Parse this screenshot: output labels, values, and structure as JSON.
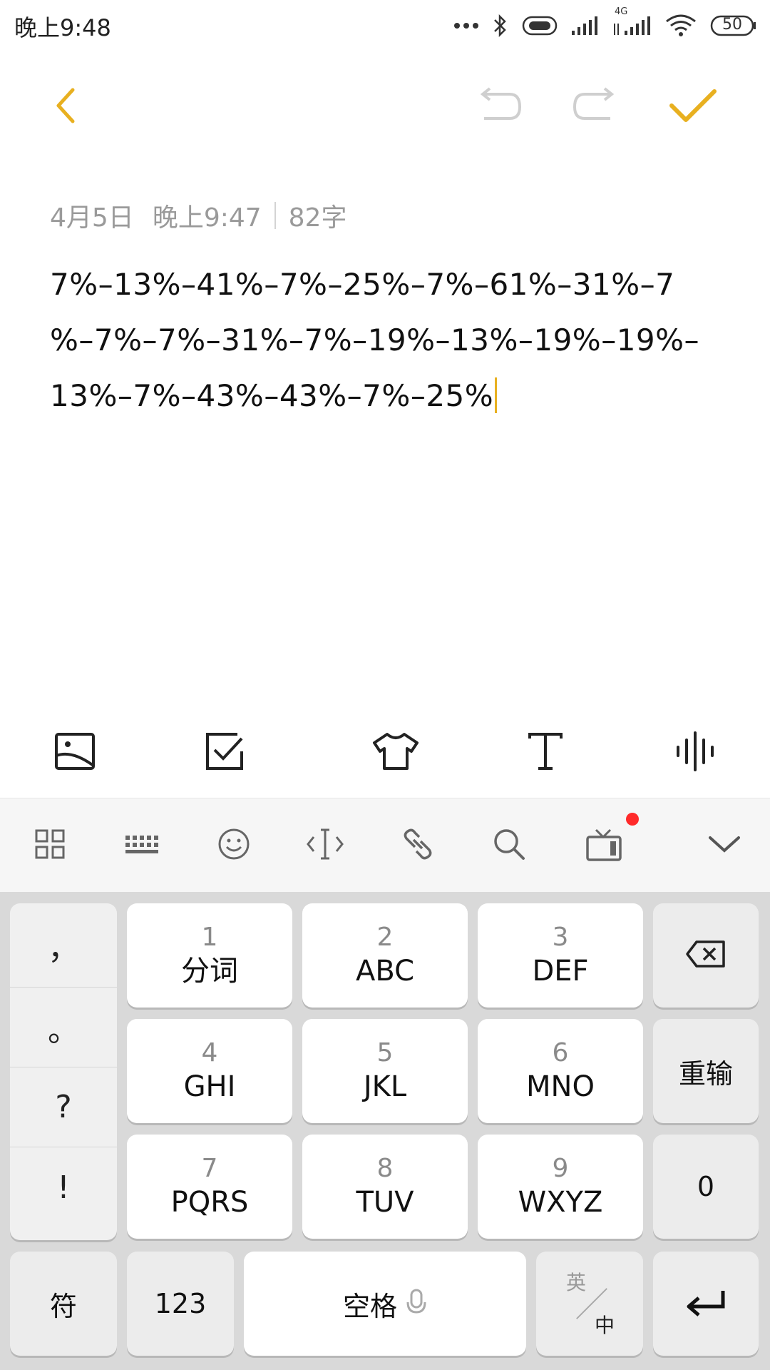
{
  "status_bar": {
    "time": "晚上9:48",
    "network_label": "4G",
    "battery": "50",
    "icons": [
      "more-dots-icon",
      "bluetooth-icon",
      "vibrate-icon",
      "signal-icon",
      "signal-4g-icon",
      "wifi-icon",
      "battery-icon"
    ]
  },
  "toolbar": {
    "icons": [
      "back-arrow-icon",
      "undo-icon",
      "redo-icon",
      "checkmark-icon"
    ],
    "accent_color": "#e8b020",
    "disabled_color": "#cfcfcf"
  },
  "note": {
    "date": "4月5日",
    "time": "晚上9:47",
    "char_count": "82字",
    "lines": [
      "7%–13%–41%–7%–25%–7%–61%–31%–7",
      "%–7%–7%–31%–7%–19%–13%–19%–19%–",
      "13%–7%–43%–43%–7%–25%"
    ]
  },
  "format_bar": {
    "icons": [
      "image-icon",
      "checkbox-icon",
      "theme-shirt-icon",
      "text-format-icon",
      "voice-wave-icon"
    ]
  },
  "keyboard_toolbar": {
    "icons": [
      "grid-menu-icon",
      "keyboard-icon",
      "emoji-icon",
      "cursor-icon",
      "link-icon",
      "search-icon",
      "tv-icon",
      "chevron-down-icon"
    ],
    "notification_color": "#ff2a2a"
  },
  "keyboard": {
    "punctuation": [
      "，",
      "。",
      "?",
      "!"
    ],
    "keys": [
      {
        "num": "1",
        "letters": "分词"
      },
      {
        "num": "2",
        "letters": "ABC"
      },
      {
        "num": "3",
        "letters": "DEF"
      },
      {
        "num": "4",
        "letters": "GHI"
      },
      {
        "num": "5",
        "letters": "JKL"
      },
      {
        "num": "6",
        "letters": "MNO"
      },
      {
        "num": "7",
        "letters": "PQRS"
      },
      {
        "num": "8",
        "letters": "TUV"
      },
      {
        "num": "9",
        "letters": "WXYZ"
      }
    ],
    "reenter": "重输",
    "zero": "0",
    "symbols": "符",
    "numbers": "123",
    "space": "空格",
    "lang_top": "英",
    "lang_bottom": "中"
  }
}
